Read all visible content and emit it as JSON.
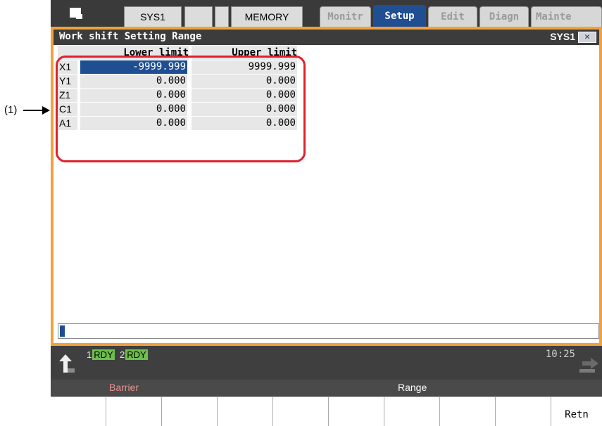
{
  "topbar": {
    "sys_label": "SYS1",
    "memory_label": "MEMORY",
    "tabs": [
      "Monitr",
      "Setup",
      "Edit",
      "Diagn",
      "Mainte"
    ],
    "active_tab": "Setup"
  },
  "window": {
    "title": "Work shift Setting Range",
    "system": "SYS1",
    "close_glyph": "✕"
  },
  "table": {
    "headers": {
      "lower": "Lower limit",
      "upper": "Upper limit"
    },
    "rows": [
      {
        "axis": "X1",
        "lower": "-9999.999",
        "upper": "9999.999"
      },
      {
        "axis": "Y1",
        "lower": "0.000",
        "upper": "0.000"
      },
      {
        "axis": "Z1",
        "lower": "0.000",
        "upper": "0.000"
      },
      {
        "axis": "C1",
        "lower": "0.000",
        "upper": "0.000"
      },
      {
        "axis": "A1",
        "lower": "0.000",
        "upper": "0.000"
      }
    ],
    "selected_cell": "X1 lower"
  },
  "status": {
    "sys1_num": "1",
    "sys1_state": "RDY",
    "sys2_num": "2",
    "sys2_state": "RDY",
    "time": "10:25"
  },
  "menu": {
    "upper": {
      "barrier": "Barrier",
      "range": "Range"
    },
    "lower_right": "Retn"
  },
  "callout": "(1)",
  "colors": {
    "window_border": "#f2a13a",
    "active_tab": "#1f4f92",
    "highlight": "#e0202e",
    "rdy": "#6bc04b"
  }
}
